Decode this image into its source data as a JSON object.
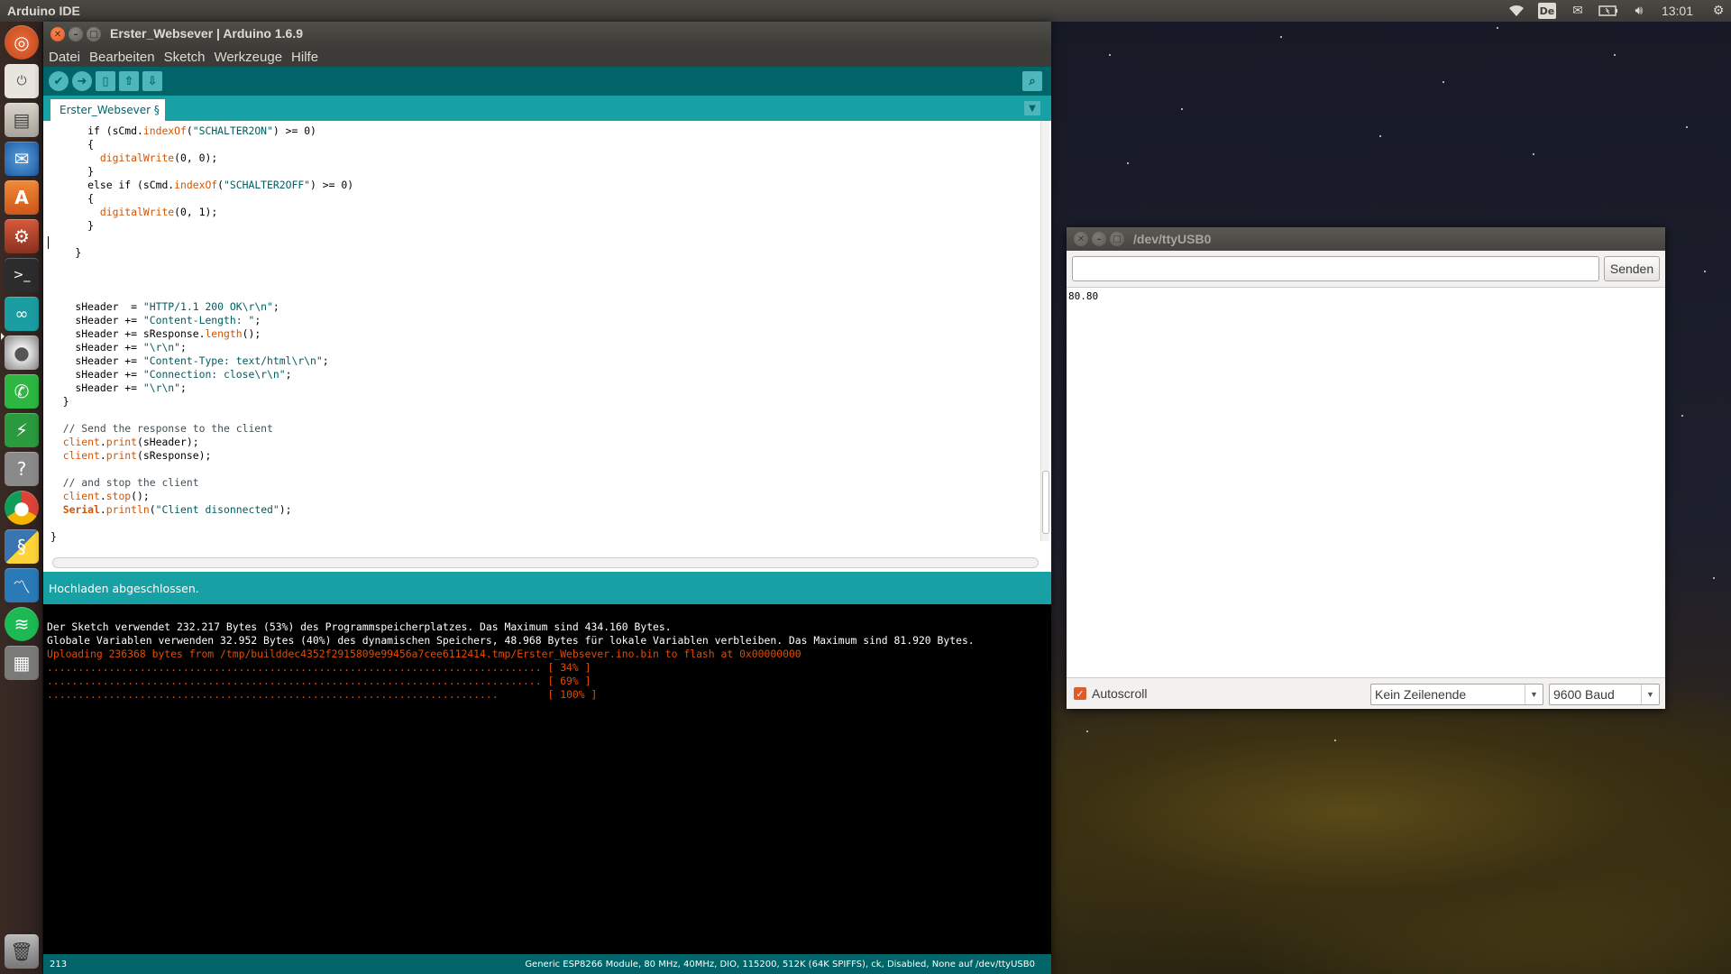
{
  "top_panel": {
    "app_name": "Arduino IDE",
    "keyboard_layout": "De",
    "clock": "13:01",
    "icons": [
      "wifi-icon",
      "mail-icon",
      "battery-icon",
      "volume-icon",
      "gear-icon"
    ]
  },
  "launcher": {
    "items": [
      "ubuntu-dash-icon",
      "power-icon",
      "files-icon",
      "thunderbird-icon",
      "software-center-icon",
      "settings-icon",
      "terminal-icon",
      "arduino-icon",
      "disc-icon",
      "whatsapp-icon",
      "lightning-icon",
      "help-icon",
      "chrome-icon",
      "python-icon",
      "chart-app-icon",
      "spotify-icon",
      "calculator-icon",
      "trash-icon"
    ]
  },
  "arduino": {
    "title": "Erster_Websever | Arduino 1.6.9",
    "menu": [
      "Datei",
      "Bearbeiten",
      "Sketch",
      "Werkzeuge",
      "Hilfe"
    ],
    "tab": "Erster_Websever §",
    "status": "Hochladen abgeschlossen.",
    "console": {
      "line1": "Der Sketch verwendet 232.217 Bytes (53%) des Programmspeicherplatzes. Das Maximum sind 434.160 Bytes.",
      "line2": "Globale Variablen verwenden 32.952 Bytes (40%) des dynamischen Speichers, 48.968 Bytes für lokale Variablen verbleiben. Das Maximum sind 81.920 Bytes.",
      "line3": "Uploading 236368 bytes from /tmp/builddec4352f2915809e99456a7cee6112414.tmp/Erster_Websever.ino.bin to flash at 0x00000000",
      "progress": [
        {
          "dots": "................................................................................",
          "pct": "[ 34% ]"
        },
        {
          "dots": "................................................................................",
          "pct": "[ 69% ]"
        },
        {
          "dots": ".........................................................................",
          "pct": "[ 100% ]"
        }
      ]
    },
    "footer": {
      "line": "213",
      "board": "Generic ESP8266 Module, 80 MHz, 40MHz, DIO, 115200, 512K (64K SPIFFS), ck, Disabled, None auf /dev/ttyUSB0"
    }
  },
  "serial": {
    "title": "/dev/ttyUSB0",
    "input_value": "",
    "send_label": "Senden",
    "output": "80.80",
    "autoscroll_label": "Autoscroll",
    "autoscroll_checked": true,
    "line_ending": "Kein Zeilenende",
    "baud": "9600 Baud"
  }
}
